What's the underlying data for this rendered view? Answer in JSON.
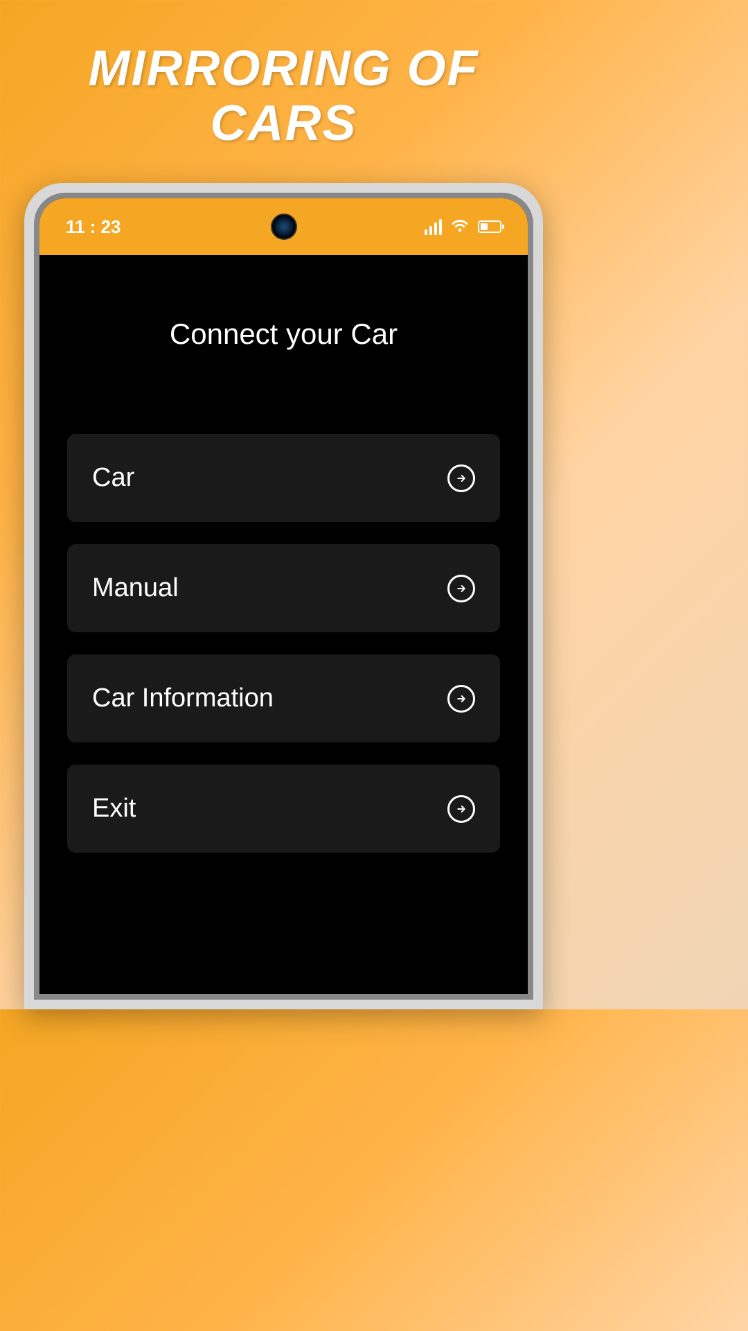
{
  "promo": {
    "title": "MIRRORING OF CARS"
  },
  "statusBar": {
    "time": "11 : 23"
  },
  "app": {
    "title": "Connect your Car",
    "menu": [
      {
        "label": "Car"
      },
      {
        "label": "Manual"
      },
      {
        "label": "Car Information"
      },
      {
        "label": "Exit"
      }
    ]
  }
}
